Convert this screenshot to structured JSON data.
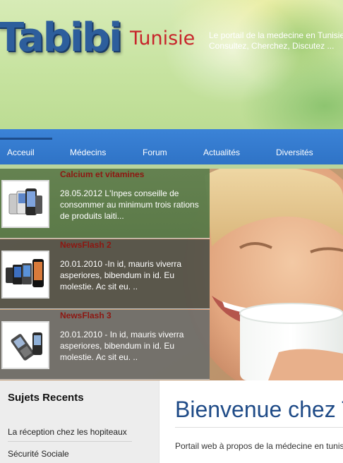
{
  "header": {
    "logo_main": "Tabibi",
    "logo_sub": "Tunisie",
    "tagline_line1": "Le portail de la medecine en Tunisie",
    "tagline_line2": "Consultez, Cherchez, Discutez ..."
  },
  "nav": {
    "items": [
      {
        "label": "Acceuil",
        "active": true
      },
      {
        "label": "Médecins"
      },
      {
        "label": "Forum"
      },
      {
        "label": "Actualités"
      },
      {
        "label": "Diversités"
      }
    ]
  },
  "news": [
    {
      "title": "Calcium et vitamines",
      "text": "28.05.2012 L'Inpes conseille de consommer au minimum trois rations de produits laiti...",
      "thumb_icon": "phones-icon"
    },
    {
      "title": "NewsFlash 2",
      "text": "20.01.2010 -In id, mauris viverra asperiores, bibendum in id. Eu molestie. Ac sit eu. ..",
      "thumb_icon": "phones-icon"
    },
    {
      "title": "NewsFlash 3",
      "text": "20.01.2010 - In id, mauris viverra asperiores, bibendum in id. Eu molestie. Ac sit eu. ..",
      "thumb_icon": "phones-icon"
    }
  ],
  "sidebar": {
    "title": "Sujets Recents",
    "links": [
      "La réception chez les hopiteaux",
      "Sécurité Sociale"
    ]
  },
  "main": {
    "title": "Bienvenue chez Tabibi",
    "intro": "Portail web à propos de la médecine en tunisie"
  },
  "colors": {
    "nav_blue": "#3b83d7",
    "logo_blue": "#2d5e9c",
    "logo_red": "#c7252b",
    "news_title_red": "#8e1711",
    "heading_blue": "#1f4b87"
  }
}
